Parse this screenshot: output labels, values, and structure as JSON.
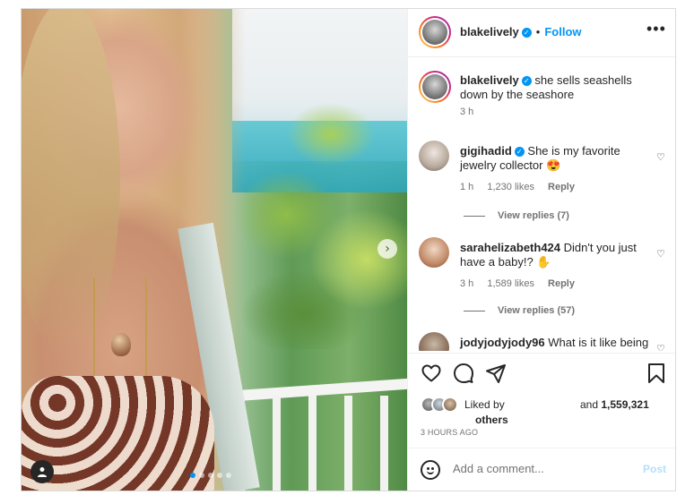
{
  "post": {
    "author": "blakelively",
    "follow_label": "Follow",
    "separator": "•",
    "more_label": "•••",
    "caption": "she sells seashells down by the seashore",
    "caption_time": "3 h"
  },
  "comments": [
    {
      "username": "gigihadid",
      "verified": true,
      "text": "She is my favorite jewelry collector 😍",
      "time": "1 h",
      "likes": "1,230 likes",
      "reply_label": "Reply",
      "view_replies": "View replies (7)"
    },
    {
      "username": "sarahelizabeth424",
      "verified": false,
      "text": "Didn't you just have a baby!? ✋",
      "time": "3 h",
      "likes": "1,589 likes",
      "reply_label": "Reply",
      "view_replies": "View replies (57)"
    },
    {
      "username": "jodyjodyjody96",
      "verified": false,
      "text": "What is it like being an actual goddess?"
    }
  ],
  "likes": {
    "liked_by": "Liked by",
    "and": "and",
    "count": "1,559,321",
    "others": "others"
  },
  "time_ago": "3 HOURS AGO",
  "add_comment": {
    "placeholder": "Add a comment...",
    "post_label": "Post"
  },
  "carousel": {
    "next_icon": "chevron-right-icon",
    "slide_count": 5,
    "active_index": 0
  },
  "colors": {
    "accent": "#0095f6",
    "muted": "#737373",
    "post_disabled": "#b2dffc"
  }
}
